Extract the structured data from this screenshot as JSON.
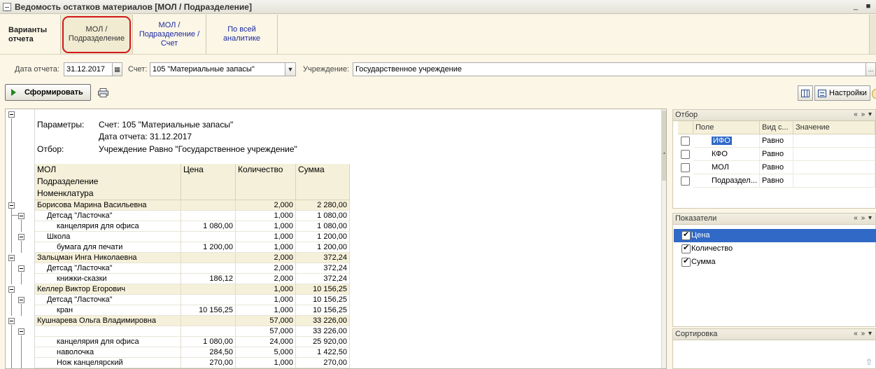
{
  "window": {
    "title": "Ведомость остатков материалов [МОЛ / Подразделение]",
    "min": "_",
    "close": "■"
  },
  "variants": {
    "label": "Варианты отчета",
    "tabs": [
      {
        "label": "МОЛ / Подразделение",
        "active": true
      },
      {
        "label": "МОЛ / Подразделение / Счет",
        "active": false
      },
      {
        "label": "По всей аналитике",
        "active": false
      }
    ]
  },
  "params": {
    "date_label": "Дата отчета:",
    "date_value": "31.12.2017",
    "account_label": "Счет:",
    "account_value": "105 \"Материальные запасы\"",
    "institution_label": "Учреждение:",
    "institution_value": "Государственное учреждение",
    "more_btn": "..."
  },
  "toolbar": {
    "generate_label": "Сформировать",
    "settings_label": "Настройки"
  },
  "report": {
    "params_caption": "Параметры:",
    "params_account": "Счет: 105 \"Материальные запасы\"",
    "params_date": "Дата отчета: 31.12.2017",
    "filter_caption": "Отбор:",
    "filter_text": "Учреждение Равно \"Государственное учреждение\"",
    "headers": {
      "mol": "МОЛ",
      "dept": "Подразделение",
      "item": "Номенклатура",
      "price": "Цена",
      "qty": "Количество",
      "sum": "Сумма"
    },
    "rows": [
      {
        "level": 0,
        "name": "Борисова Марина Васильевна",
        "price": "",
        "qty": "2,000",
        "sum": "2 280,00"
      },
      {
        "level": 1,
        "name": "Детсад \"Ласточка\"",
        "price": "",
        "qty": "1,000",
        "sum": "1 080,00"
      },
      {
        "level": 2,
        "name": "канцелярия для офиса",
        "price": "1 080,00",
        "qty": "1,000",
        "sum": "1 080,00"
      },
      {
        "level": 1,
        "name": "Школа",
        "price": "",
        "qty": "1,000",
        "sum": "1 200,00"
      },
      {
        "level": 2,
        "name": "бумага для печати",
        "price": "1 200,00",
        "qty": "1,000",
        "sum": "1 200,00"
      },
      {
        "level": 0,
        "name": "Зальцман Инга Николаевна",
        "price": "",
        "qty": "2,000",
        "sum": "372,24"
      },
      {
        "level": 1,
        "name": "Детсад \"Ласточка\"",
        "price": "",
        "qty": "2,000",
        "sum": "372,24"
      },
      {
        "level": 2,
        "name": "книжки-сказки",
        "price": "186,12",
        "qty": "2,000",
        "sum": "372,24"
      },
      {
        "level": 0,
        "name": "Келлер Виктор Егорович",
        "price": "",
        "qty": "1,000",
        "sum": "10 156,25"
      },
      {
        "level": 1,
        "name": "Детсад \"Ласточка\"",
        "price": "",
        "qty": "1,000",
        "sum": "10 156,25"
      },
      {
        "level": 2,
        "name": "кран",
        "price": "10 156,25",
        "qty": "1,000",
        "sum": "10 156,25"
      },
      {
        "level": 0,
        "name": "Кушнарева Ольга Владимировна",
        "price": "",
        "qty": "57,000",
        "sum": "33 226,00"
      },
      {
        "level": 1,
        "name": "",
        "price": "",
        "qty": "57,000",
        "sum": "33 226,00"
      },
      {
        "level": 2,
        "name": "канцелярия для офиса",
        "price": "1 080,00",
        "qty": "24,000",
        "sum": "25 920,00"
      },
      {
        "level": 2,
        "name": "наволочка",
        "price": "284,50",
        "qty": "5,000",
        "sum": "1 422,50"
      },
      {
        "level": 2,
        "name": "Нож канцелярский",
        "price": "270,00",
        "qty": "1,000",
        "sum": "270,00"
      }
    ]
  },
  "filter_panel": {
    "title": "Отбор",
    "chevrons": "« » ▾",
    "headers": {
      "field": "Поле",
      "type": "Вид с...",
      "value": "Значение"
    },
    "rows": [
      {
        "field": "ИФО",
        "type": "Равно",
        "value": "",
        "checked": false,
        "selected": true
      },
      {
        "field": "КФО",
        "type": "Равно",
        "value": "",
        "checked": false,
        "selected": false
      },
      {
        "field": "МОЛ",
        "type": "Равно",
        "value": "",
        "checked": false,
        "selected": false
      },
      {
        "field": "Подраздел...",
        "type": "Равно",
        "value": "",
        "checked": false,
        "selected": false
      }
    ]
  },
  "indicators_panel": {
    "title": "Показатели",
    "chevrons": "« » ▾",
    "items": [
      {
        "label": "Цена",
        "checked": true
      },
      {
        "label": "Количество",
        "checked": true
      },
      {
        "label": "Сумма",
        "checked": true
      }
    ]
  },
  "sort_panel": {
    "title": "Сортировка",
    "chevrons": "« » ▾"
  },
  "colors": {
    "accent_ring": "#d21818",
    "selection": "#3169c6",
    "header_bg": "#f5f0d9",
    "link": "#1b2aa0"
  }
}
